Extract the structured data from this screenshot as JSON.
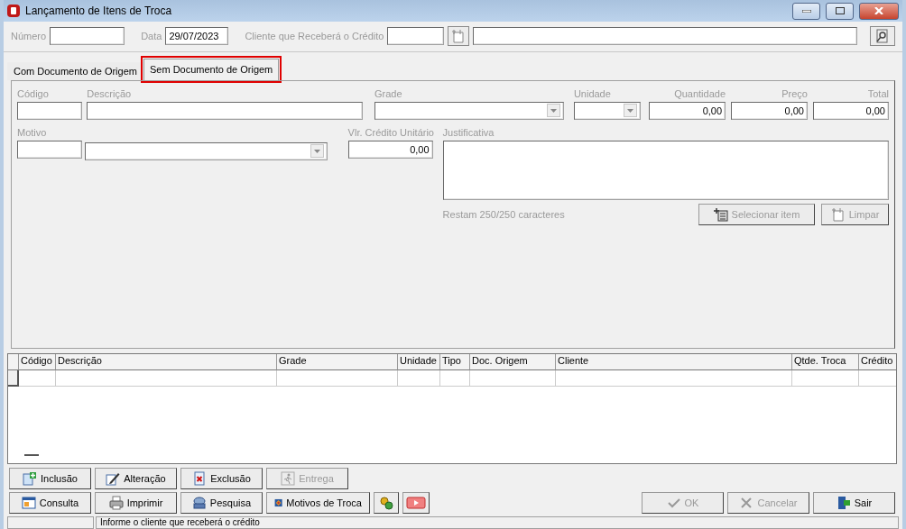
{
  "window": {
    "title": "Lançamento de Itens de Troca"
  },
  "header": {
    "numero": {
      "label": "Número"
    },
    "data": {
      "label": "Data",
      "value": "29/07/2023"
    },
    "cliente": {
      "label": "Cliente que Receberá o Crédito"
    }
  },
  "tabs": [
    {
      "label": "Com Documento de Origem",
      "selected": false,
      "highlighted": false
    },
    {
      "label": "Sem Documento de Origem",
      "selected": true,
      "highlighted": true
    }
  ],
  "form": {
    "row1": [
      {
        "label": "Código",
        "kind": "text"
      },
      {
        "label": "Descrição",
        "kind": "text"
      },
      {
        "label": "Grade",
        "kind": "combo"
      },
      {
        "label": "Unidade",
        "kind": "combo"
      },
      {
        "label": "Quantidade",
        "kind": "number",
        "value": "0,00"
      },
      {
        "label": "Preço",
        "kind": "number",
        "value": "0,00"
      },
      {
        "label": "Total",
        "kind": "number",
        "value": "0,00"
      }
    ],
    "motivo": {
      "label": "Motivo"
    },
    "credito": {
      "label": "Vlr. Crédito Unitário",
      "value": "0,00"
    },
    "justificativa": {
      "label": "Justificativa",
      "counter": "Restam 250/250 caracteres"
    },
    "buttons": [
      {
        "label": "Selecionar item",
        "disabled": true
      },
      {
        "label": "Limpar",
        "disabled": true
      }
    ]
  },
  "grid": {
    "columns": [
      "Código",
      "Descrição",
      "Grade",
      "Unidade",
      "Tipo",
      "Doc. Origem",
      "Cliente",
      "Qtde. Troca",
      "Crédito"
    ]
  },
  "toolbar": {
    "row1": [
      {
        "label": "Inclusão",
        "disabled": false
      },
      {
        "label": "Alteração",
        "disabled": false
      },
      {
        "label": "Exclusão",
        "disabled": false
      },
      {
        "label": "Entrega",
        "disabled": true
      }
    ],
    "row2": [
      {
        "label": "Consulta",
        "disabled": false
      },
      {
        "label": "Imprimir",
        "disabled": false
      },
      {
        "label": "Pesquisa",
        "disabled": false
      },
      {
        "label": "Motivos de Troca",
        "disabled": false
      }
    ],
    "actions": [
      {
        "label": "OK",
        "disabled": true
      },
      {
        "label": "Cancelar",
        "disabled": true
      },
      {
        "label": "Sair",
        "disabled": false
      }
    ]
  },
  "status_bar": {
    "text": "Informe o cliente que receberá o crédito"
  }
}
